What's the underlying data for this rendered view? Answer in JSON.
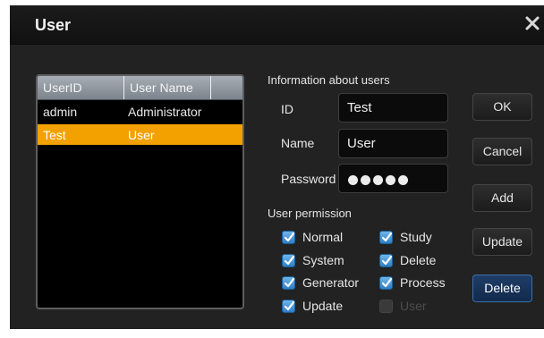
{
  "window": {
    "title": "User"
  },
  "user_list": {
    "columns": [
      "UserID",
      "User Name"
    ],
    "rows": [
      {
        "id": "admin",
        "name": "Administrator",
        "selected": false
      },
      {
        "id": "Test",
        "name": "User",
        "selected": true
      }
    ]
  },
  "info": {
    "section_label": "Information about users",
    "id_label": "ID",
    "id_value": "Test",
    "name_label": "Name",
    "name_value": "User",
    "password_label": "Password",
    "password_mask_length": 5
  },
  "permissions": {
    "section_label": "User permission",
    "items": [
      {
        "label": "Normal",
        "checked": true,
        "enabled": true
      },
      {
        "label": "Study",
        "checked": true,
        "enabled": true
      },
      {
        "label": "System",
        "checked": true,
        "enabled": true
      },
      {
        "label": "Delete",
        "checked": true,
        "enabled": true
      },
      {
        "label": "Generator",
        "checked": true,
        "enabled": true
      },
      {
        "label": "Process",
        "checked": true,
        "enabled": true
      },
      {
        "label": "Update",
        "checked": true,
        "enabled": true
      },
      {
        "label": "User",
        "checked": false,
        "enabled": false
      }
    ]
  },
  "buttons": {
    "ok": "OK",
    "cancel": "Cancel",
    "add": "Add",
    "update": "Update",
    "delete": "Delete"
  },
  "colors": {
    "selection": "#f2a100",
    "checkbox": "#2d7fc6",
    "primary_button": "#1f3d66"
  }
}
